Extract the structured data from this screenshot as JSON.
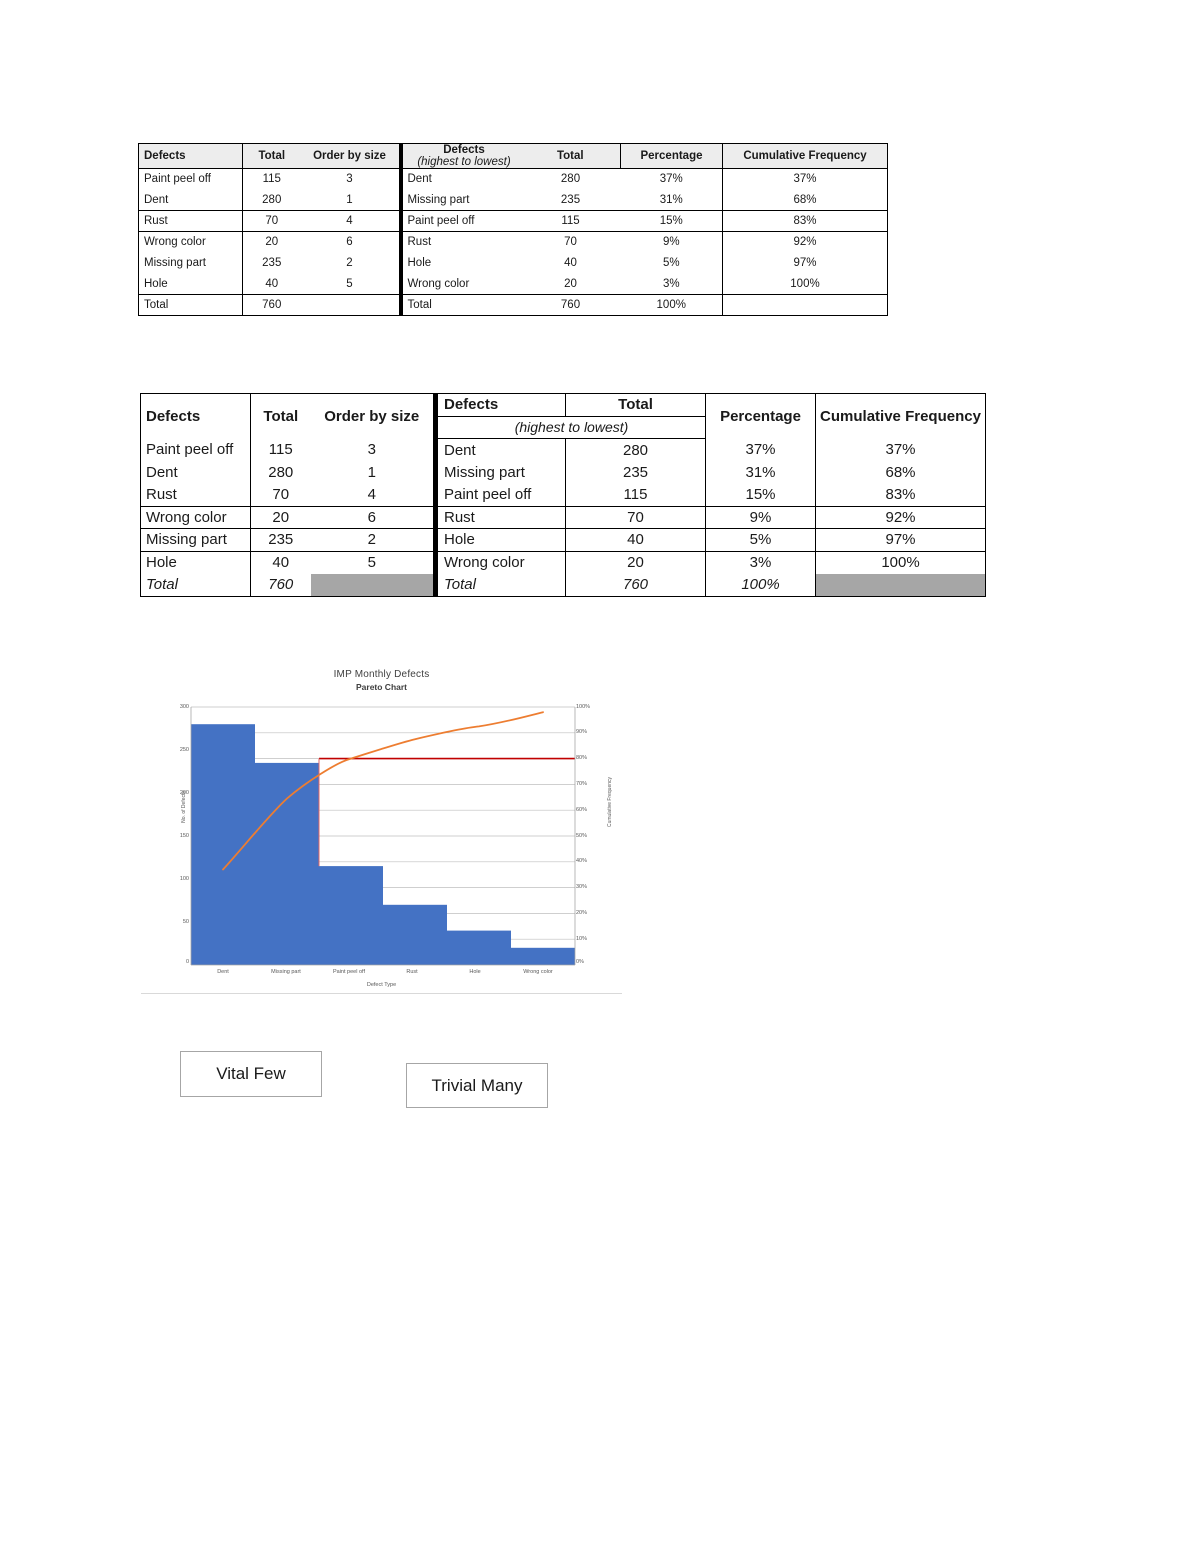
{
  "table1": {
    "left": {
      "headers": [
        "Defects",
        "Total",
        "Order by size"
      ],
      "rows": [
        {
          "defect": "Paint peel off",
          "total": "115",
          "order": "3"
        },
        {
          "defect": "Dent",
          "total": "280",
          "order": "1"
        },
        {
          "defect": "Rust",
          "total": "70",
          "order": "4"
        },
        {
          "defect": "Wrong color",
          "total": "20",
          "order": "6"
        },
        {
          "defect": "Missing part",
          "total": "235",
          "order": "2"
        },
        {
          "defect": "Hole",
          "total": "40",
          "order": "5"
        }
      ],
      "total_row": {
        "label": "Total",
        "total": "760",
        "order": ""
      }
    },
    "right": {
      "header_defects": "Defects",
      "header_total": "Total",
      "header_sub": "(highest to lowest)",
      "header_percentage": "Percentage",
      "header_cumulative": "Cumulative Frequency",
      "rows": [
        {
          "defect": "Dent",
          "total": "280",
          "percentage": "37%",
          "cumulative": "37%"
        },
        {
          "defect": "Missing part",
          "total": "235",
          "percentage": "31%",
          "cumulative": "68%"
        },
        {
          "defect": "Paint peel off",
          "total": "115",
          "percentage": "15%",
          "cumulative": "83%"
        },
        {
          "defect": "Rust",
          "total": "70",
          "percentage": "9%",
          "cumulative": "92%"
        },
        {
          "defect": "Hole",
          "total": "40",
          "percentage": "5%",
          "cumulative": "97%"
        },
        {
          "defect": "Wrong color",
          "total": "20",
          "percentage": "3%",
          "cumulative": "100%"
        }
      ],
      "total_row": {
        "label": "Total",
        "total": "760",
        "percentage": "100%",
        "cumulative": ""
      }
    }
  },
  "table2": {
    "left": {
      "headers": [
        "Defects",
        "Total",
        "Order by size"
      ],
      "rows": [
        {
          "defect": "Paint peel off",
          "total": "115",
          "order": "3"
        },
        {
          "defect": "Dent",
          "total": "280",
          "order": "1"
        },
        {
          "defect": "Rust",
          "total": "70",
          "order": "4"
        },
        {
          "defect": "Wrong color",
          "total": "20",
          "order": "6"
        },
        {
          "defect": "Missing part",
          "total": "235",
          "order": "2"
        },
        {
          "defect": "Hole",
          "total": "40",
          "order": "5"
        }
      ],
      "total_row": {
        "label": "Total",
        "total": "760",
        "order": ""
      }
    },
    "right": {
      "header_defects": "Defects",
      "header_total": "Total",
      "header_sub": "(highest to lowest)",
      "header_percentage": "Percentage",
      "header_cumulative": "Cumulative Frequency",
      "rows": [
        {
          "defect": "Dent",
          "total": "280",
          "percentage": "37%",
          "cumulative": "37%"
        },
        {
          "defect": "Missing part",
          "total": "235",
          "percentage": "31%",
          "cumulative": "68%"
        },
        {
          "defect": "Paint peel off",
          "total": "115",
          "percentage": "15%",
          "cumulative": "83%"
        },
        {
          "defect": "Rust",
          "total": "70",
          "percentage": "9%",
          "cumulative": "92%"
        },
        {
          "defect": "Hole",
          "total": "40",
          "percentage": "5%",
          "cumulative": "97%"
        },
        {
          "defect": "Wrong color",
          "total": "20",
          "percentage": "3%",
          "cumulative": "100%"
        }
      ],
      "total_row": {
        "label": "Total",
        "total": "760",
        "percentage": "100%",
        "cumulative": ""
      }
    }
  },
  "chart_data": {
    "type": "bar",
    "title": "IMP Monthly Defects",
    "subtitle": "Pareto Chart",
    "categories": [
      "Dent",
      "Missing part",
      "Paint peel off",
      "Rust",
      "Hole",
      "Wrong color"
    ],
    "values": [
      280,
      235,
      115,
      70,
      40,
      20
    ],
    "series": [
      {
        "name": "No. of Defects",
        "type": "bar",
        "values": [
          280,
          235,
          115,
          70,
          40,
          20
        ]
      },
      {
        "name": "Cumulative Frequency",
        "type": "line",
        "values": [
          37,
          68,
          83,
          92,
          97,
          100
        ]
      }
    ],
    "xlabel": "Defect Type",
    "ylabel": "No. of Defects",
    "y2label": "Cumulative Frequency",
    "ylim": [
      0,
      300
    ],
    "y2lim": [
      0,
      100
    ],
    "yticks": [
      "300",
      "250",
      "200",
      "150",
      "100",
      "50",
      "0"
    ],
    "y2ticks": [
      "100%",
      "90%",
      "80%",
      "70%",
      "60%",
      "50%",
      "40%",
      "30%",
      "20%",
      "10%",
      "0%"
    ],
    "grid": true,
    "legend": "none",
    "bar_color": "#4472C4",
    "line_color": "#ED7D31",
    "threshold_line_color": "#C00000",
    "threshold_value": 80,
    "threshold_label": "80%"
  },
  "callouts": {
    "vital_few": "Vital Few",
    "trivial_many": "Trivial Many"
  }
}
